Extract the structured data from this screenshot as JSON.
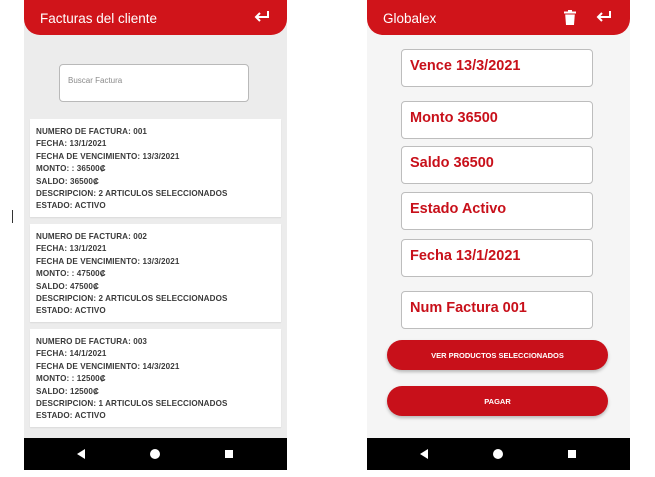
{
  "left_screen": {
    "appbar": {
      "title": "Facturas del cliente",
      "back_icon": "return-arrow-icon",
      "color": "#d0141a"
    },
    "search": {
      "placeholder": "Buscar Factura"
    },
    "invoices": [
      {
        "lines": [
          "NUMERO DE FACTURA: 001",
          "FECHA: 13/1/2021",
          "FECHA DE VENCIMIENTO: 13/3/2021",
          "MONTO: : 36500₡",
          "SALDO: 36500₡",
          "DESCRIPCION: 2 ARTICULOS SELECCIONADOS",
          "ESTADO: ACTIVO"
        ]
      },
      {
        "lines": [
          "NUMERO DE FACTURA: 002",
          "FECHA: 13/1/2021",
          "FECHA DE VENCIMIENTO: 13/3/2021",
          "MONTO: : 47500₡",
          "SALDO: 47500₡",
          "DESCRIPCION: 2 ARTICULOS SELECCIONADOS",
          "ESTADO: ACTIVO"
        ]
      },
      {
        "lines": [
          "NUMERO DE FACTURA: 003",
          "FECHA: 14/1/2021",
          "FECHA DE VENCIMIENTO: 14/3/2021",
          "MONTO: : 12500₡",
          "SALDO: 12500₡",
          "DESCRIPCION: 1 ARTICULOS SELECCIONADOS",
          "ESTADO: ACTIVO"
        ]
      }
    ]
  },
  "right_screen": {
    "appbar": {
      "title": "Globalex",
      "trash_icon": "trash-icon",
      "back_icon": "return-arrow-icon"
    },
    "fields": {
      "vence": "Vence 13/3/2021",
      "monto": "Monto 36500",
      "saldo": "Saldo 36500",
      "estado": "Estado Activo",
      "fecha": "Fecha 13/1/2021",
      "num_factura": "Num Factura 001"
    },
    "buttons": {
      "ver_productos": "VER PRODUCTOS SELECCIONADOS",
      "pagar": "PAGAR"
    }
  },
  "navbar": {
    "icons": [
      "nav-back-icon",
      "nav-home-icon",
      "nav-recents-icon"
    ]
  }
}
